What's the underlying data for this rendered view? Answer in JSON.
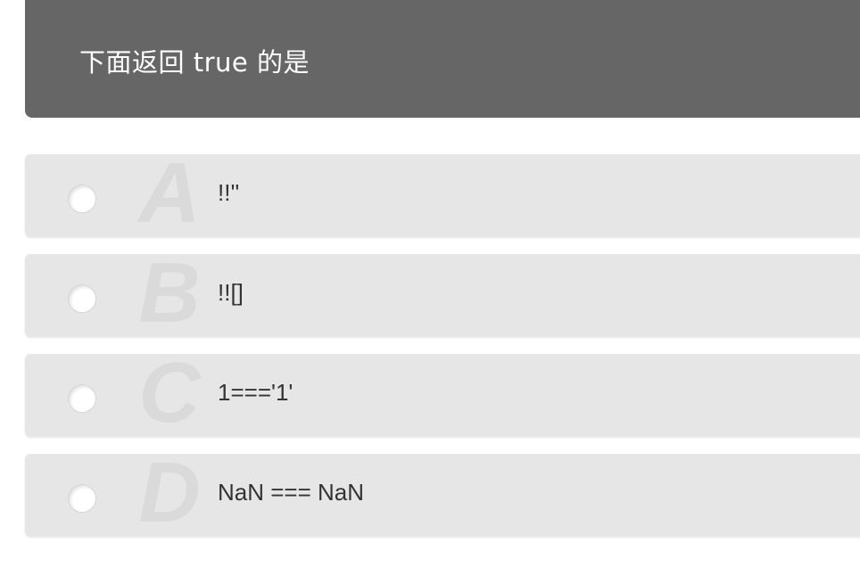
{
  "question": {
    "text": "下面返回 true 的是"
  },
  "options": [
    {
      "letter": "A",
      "text": "!!''"
    },
    {
      "letter": "B",
      "text": "!![]"
    },
    {
      "letter": "C",
      "text": "1==='1'"
    },
    {
      "letter": "D",
      "text": "NaN === NaN"
    }
  ],
  "colors": {
    "header_bg": "#666666",
    "option_bg": "#e6e6e6",
    "letter_watermark": "#dadada"
  }
}
